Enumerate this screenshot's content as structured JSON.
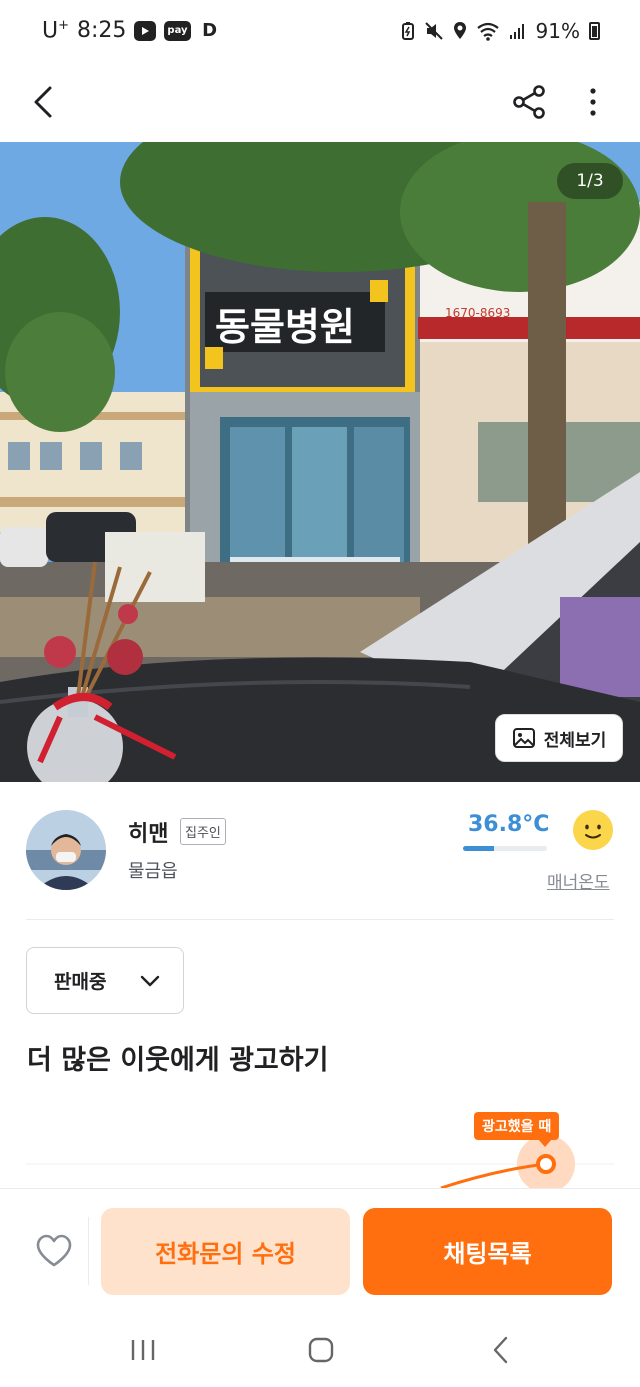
{
  "status_bar": {
    "carrier": "U",
    "carrier_sup": "+",
    "time": "8:25",
    "badges": [
      "yt-icon",
      "pay",
      "D"
    ],
    "battery": "91%"
  },
  "app_bar": {
    "back_icon": "chevron-left-icon",
    "share_icon": "share-icon",
    "more_icon": "more-vertical-icon"
  },
  "photo": {
    "page_indicator": "1/3",
    "sign_text": "동물병원",
    "phone_text": "1670-8693",
    "fullview_label": "전체보기"
  },
  "seller": {
    "name": "히맨",
    "badge": "집주인",
    "location": "물금읍",
    "manner_temperature": "36.8°C",
    "manner_temperature_fraction": 0.37,
    "manner_label": "매너온도",
    "temp_color": "#3c8fd6"
  },
  "sale_status": {
    "selected": "판매중"
  },
  "ad": {
    "title": "더 많은 이웃에게 광고하기",
    "tooltip": "광고했을 때"
  },
  "actions": {
    "edit_label": "전화문의 수정",
    "chat_label": "채팅목록",
    "accent_color": "#ff6f0f"
  },
  "system_nav": {
    "items": [
      "recent-apps-icon",
      "home-icon",
      "back-icon"
    ]
  }
}
